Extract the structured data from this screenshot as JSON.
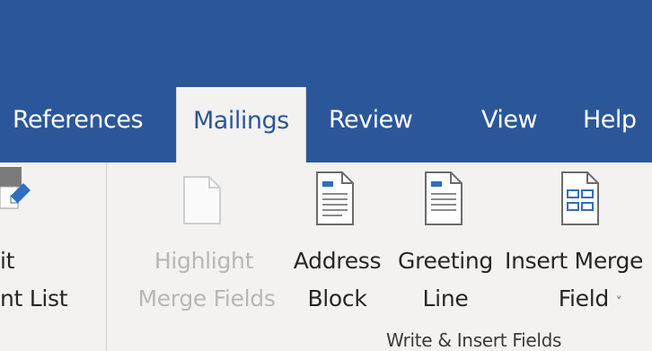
{
  "ribbon_tabs": [
    {
      "label": "References",
      "active": false
    },
    {
      "label": "Mailings",
      "active": true
    },
    {
      "label": "Review",
      "active": false
    },
    {
      "label": "View",
      "active": false
    },
    {
      "label": "Help",
      "active": false
    }
  ],
  "commands": {
    "edit_list": {
      "line1": "it",
      "line2": "nt List",
      "icon": "edit-recipient-list-icon"
    },
    "highlight": {
      "line1": "Highlight",
      "line2": "Merge Fields",
      "icon": "highlight-merge-fields-icon",
      "disabled": true
    },
    "address_block": {
      "line1": "Address",
      "line2": "Block",
      "icon": "address-block-icon"
    },
    "greeting_line": {
      "line1": "Greeting",
      "line2": "Line",
      "icon": "greeting-line-icon"
    },
    "insert_merge": {
      "line1": "Insert Merge",
      "line2": "Field",
      "dropdown": "˅",
      "icon": "insert-merge-field-icon"
    }
  },
  "group": {
    "label": "Write & Insert Fields"
  },
  "colors": {
    "brand": "#2b579a",
    "ribbon_bg": "#f3f2f1",
    "text": "#262626",
    "disabled_text": "#b9b7b5"
  }
}
